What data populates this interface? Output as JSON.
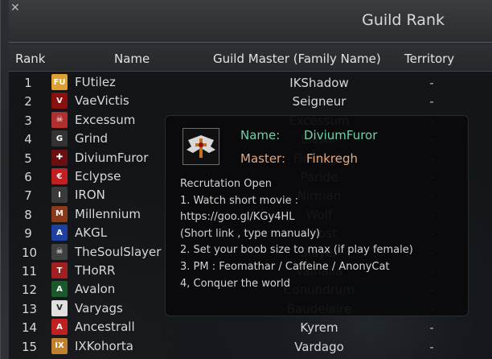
{
  "window": {
    "title": "Guild Rank"
  },
  "columns": {
    "rank": "Rank",
    "name": "Name",
    "master": "Guild Master (Family Name)",
    "territory": "Territory"
  },
  "rows": [
    {
      "rank": "1",
      "name": "FUtilez",
      "master": "IKShadow",
      "territory": "-",
      "emblem_text": "FU",
      "emblem_color": "#e0a030"
    },
    {
      "rank": "2",
      "name": "VaeVictis",
      "master": "Seigneur",
      "territory": "-",
      "emblem_text": "V",
      "emblem_color": "#8a1010"
    },
    {
      "rank": "3",
      "name": "Excessum",
      "master": "Excessum",
      "territory": "-",
      "emblem_text": "☠",
      "emblem_color": "#b03030"
    },
    {
      "rank": "4",
      "name": "Grind",
      "master": "Elesar",
      "territory": "-",
      "emblem_text": "G",
      "emblem_color": "#333333"
    },
    {
      "rank": "5",
      "name": "DiviumFuror",
      "master": "Finkregh",
      "territory": "-",
      "emblem_text": "✚",
      "emblem_color": "#6a1010"
    },
    {
      "rank": "6",
      "name": "Eclypse",
      "master": "Paride",
      "territory": "-",
      "emblem_text": "€",
      "emblem_color": "#c02020"
    },
    {
      "rank": "7",
      "name": "IRON",
      "master": "Nirman",
      "territory": "-",
      "emblem_text": "I",
      "emblem_color": "#3a3a3a"
    },
    {
      "rank": "8",
      "name": "Millennium",
      "master": "Wolf",
      "territory": "-",
      "emblem_text": "M",
      "emblem_color": "#8a3a1a"
    },
    {
      "rank": "9",
      "name": "AKGL",
      "master": "Ghost",
      "territory": "-",
      "emblem_text": "A",
      "emblem_color": "#2040a0"
    },
    {
      "rank": "10",
      "name": "TheSoulSlayer",
      "master": "Slayer",
      "territory": "-",
      "emblem_text": "☠",
      "emblem_color": "#404040"
    },
    {
      "rank": "11",
      "name": "THoRR",
      "master": "Valhalla",
      "territory": "-",
      "emblem_text": "T",
      "emblem_color": "#a02020"
    },
    {
      "rank": "12",
      "name": "Avalon",
      "master": "Conundrum",
      "territory": "-",
      "emblem_text": "A",
      "emblem_color": "#1a5a2a"
    },
    {
      "rank": "13",
      "name": "Varyags",
      "master": "Baudelaire",
      "territory": "-",
      "emblem_text": "V",
      "emblem_color": "#e0e0e0"
    },
    {
      "rank": "14",
      "name": "Ancestrall",
      "master": "Kyrem",
      "territory": "-",
      "emblem_text": "A",
      "emblem_color": "#c02020"
    },
    {
      "rank": "15",
      "name": "IXKohorta",
      "master": "Vardago",
      "territory": "-",
      "emblem_text": "IX",
      "emblem_color": "#c08030"
    }
  ],
  "popup": {
    "name_label": "Name:",
    "name_value": "DiviumFuror",
    "master_label": "Master:",
    "master_value": "Finkregh",
    "lines": [
      "Recrutation Open",
      "1. Watch short movie :",
      "https://goo.gl/KGy4HL",
      "(Short link , type manualy)",
      "2. Set your boob size to max (if play female)",
      "3. PM : Feomathar / Caffeine / AnonyCat",
      "4, Conquer the world"
    ]
  }
}
